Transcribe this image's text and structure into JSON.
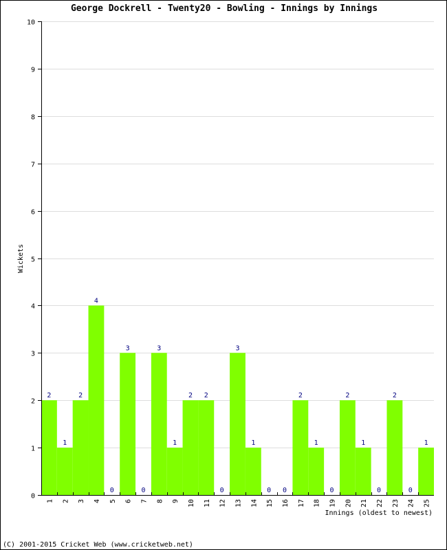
{
  "chart_data": {
    "type": "bar",
    "title": "George Dockrell - Twenty20 - Bowling - Innings by Innings",
    "xlabel": "Innings (oldest to newest)",
    "ylabel": "Wickets",
    "ylim": [
      0,
      10
    ],
    "yticks": [
      0,
      1,
      2,
      3,
      4,
      5,
      6,
      7,
      8,
      9,
      10
    ],
    "grid": true,
    "bar_color": "#80ff00",
    "label_color": "#000080",
    "categories": [
      "1",
      "2",
      "3",
      "4",
      "5",
      "6",
      "7",
      "8",
      "9",
      "10",
      "11",
      "12",
      "13",
      "14",
      "15",
      "16",
      "17",
      "18",
      "19",
      "20",
      "21",
      "22",
      "23",
      "24",
      "25"
    ],
    "values": [
      2,
      1,
      2,
      4,
      0,
      3,
      0,
      3,
      1,
      2,
      2,
      0,
      3,
      1,
      0,
      0,
      2,
      1,
      0,
      2,
      1,
      0,
      2,
      0,
      1
    ]
  },
  "footer": {
    "copyright": "(C) 2001-2015 Cricket Web (www.cricketweb.net)"
  }
}
